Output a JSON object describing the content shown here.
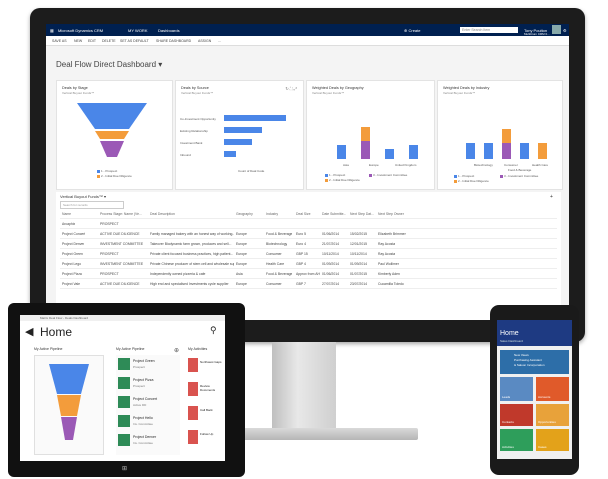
{
  "monitor": {
    "nav": {
      "app_title": "Microsoft Dynamics CRM",
      "menu": "MY WORK",
      "area": "Dashboards",
      "create": "Create",
      "search_placeholder": "Enter Search Item",
      "user_name": "Tony Poulton",
      "user_org": "Multitrium CRM 0..."
    },
    "commands": [
      "SAVE AS",
      "NEW",
      "EDIT",
      "DELETE",
      "SET AS DEFAULT",
      "SHARE DASHBOARD",
      "ASSIGN",
      "..."
    ],
    "dashboard_title": "Deal Flow Direct Dashboard",
    "charts": [
      {
        "title": "Deals by Stage",
        "subtitle": "Vertical Buyout Funds™",
        "legend": [
          "1 - Prospect",
          "2 - Initial Due Diligence"
        ]
      },
      {
        "title": "Deals by Source",
        "subtitle": "Vertical Buyout Funds™",
        "categories": [
          "Co-Investment Opportunity",
          "Existing Relationship",
          "Investment Bank",
          "Inbound"
        ],
        "values": [
          12,
          7,
          5,
          2
        ],
        "xlabel": "Count of Deal Code"
      },
      {
        "title": "Weighted Deals by Geography",
        "subtitle": "Vertical Buyout Funds™",
        "categories": [
          "Asia",
          "Europe",
          "United Kingdom"
        ],
        "legend": [
          "1 - Prospect",
          "2 - Initial Due Diligence",
          "3 - Investment Committee"
        ]
      },
      {
        "title": "Weighted Deals by Industry",
        "subtitle": "Vertical Buyout Funds™",
        "categories": [
          "Biotechnology",
          "Consumer",
          "Food & Beverage",
          "Health Care"
        ],
        "legend": [
          "1 - Prospect",
          "2 - Initial Due Diligence",
          "3 - Investment Committee"
        ]
      }
    ],
    "grid": {
      "view_name": "Vertical Buyout Funds™",
      "search_placeholder": "Search for records",
      "columns": [
        "Name",
        "Process Stage: Name (Ve...",
        "Deal Description",
        "Geography",
        "Industry",
        "Deal Size",
        "Date Submitte...",
        "Next Step Dat...",
        "Next Step Owner"
      ],
      "rows": [
        [
          "Arcaphix",
          "PROSPECT",
          "",
          "",
          "",
          "",
          "",
          "",
          ""
        ],
        [
          "Project Concert",
          "ACTIVE DUE DILIGENCE",
          "Family managed bakery with an honest way of working...",
          "Europe",
          "Food & Beverage",
          "Euro 5",
          "01/06/2014",
          "15/02/2015",
          "Elizabeth Brimmen"
        ],
        [
          "Project Denver",
          "INVESTMENT COMMITTEE",
          "Takeover Biodynamic farm grown, produces and sell...",
          "Europe",
          "Biotechnology",
          "Euro 4",
          "21/07/2014",
          "12/01/2015",
          "Ray Acosta"
        ],
        [
          "Project Green",
          "PROSPECT",
          "Private client focused business practices, high patient...",
          "Europe",
          "Consumer",
          "GBP 15",
          "10/11/2014",
          "10/11/2014",
          "Ray Acosta"
        ],
        [
          "Project Lego",
          "INVESTMENT COMMITTEE",
          "Private Chinese producer of stem cell and wholesale suppli...",
          "Europe",
          "Health Care",
          "GBP 4",
          "01/09/2014",
          "01/09/2014",
          "Paul Wollimer"
        ],
        [
          "Project Pizza",
          "PROSPECT",
          "Independently owned pizzeria & cafe",
          "Asia",
          "Food & Beverage",
          "Approx from AH",
          "01/06/2014",
          "01/07/2015",
          "Kimberly Aden"
        ],
        [
          "Project Vale",
          "ACTIVE DUE DILIGENCE",
          "High end and specialised Investments cycle supplier",
          "Europe",
          "Consumer",
          "GBP 7",
          "27/07/2014",
          "23/07/2014",
          "Cucamilla Toledo"
        ]
      ]
    }
  },
  "tablet": {
    "app_bar": "Matrix Deal Flow - Deals Dashboard",
    "title": "Home",
    "sections": [
      "My Active Pipeline",
      "My Active Pipeline",
      "My Activities"
    ],
    "deals": [
      "Project Green",
      "Project Pizza",
      "Project Concert",
      "Project Hello",
      "Project Denver"
    ],
    "deal_subs": [
      "Prospect",
      "Prospect",
      "Active DD",
      "Inv. Committee",
      "Inv. Committee"
    ],
    "activities": [
      "Northwest Gaps",
      "Review Documents",
      "Call Back",
      "Follow Up"
    ]
  },
  "phone": {
    "title": "Home",
    "subtitle": "Sales Dashboard",
    "tiles": [
      "New Views",
      "Purchasing Assistant",
      "& Saloon Incorporation",
      "Leads",
      "Accounts",
      "Contacts",
      "Opportunities",
      "Activities",
      "Cases"
    ]
  },
  "colors": {
    "nav": "#002050",
    "bar_blue": "#4a86e8",
    "orange": "#f39c3b",
    "purple": "#9b59b6"
  }
}
